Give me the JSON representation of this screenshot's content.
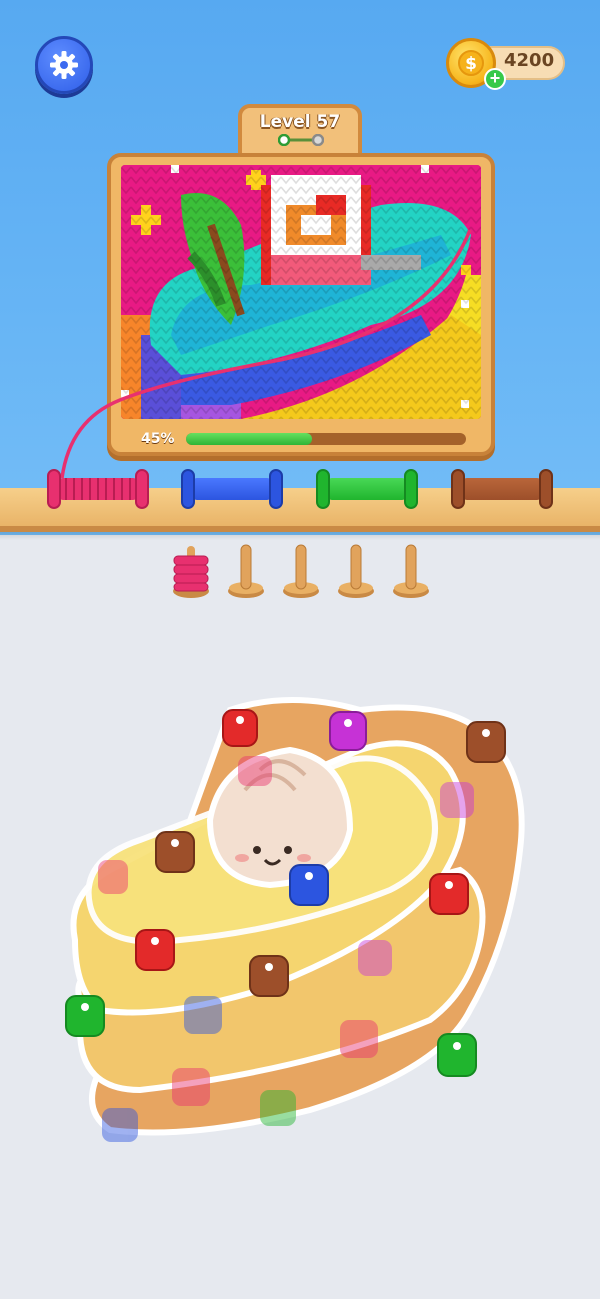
{
  "header": {
    "settings_icon": "gear-icon",
    "coins": "4200",
    "coin_icon": "dollar-coin-icon",
    "add_coins_icon": "plus-icon"
  },
  "level": {
    "label": "Level 57"
  },
  "artwork": {
    "subject": "rose-pixel-art"
  },
  "progress": {
    "label": "45%",
    "value": 0.45
  },
  "spools": [
    {
      "color": "#e8306f",
      "state": "filling"
    },
    {
      "color": "#2c55e0",
      "state": "empty"
    },
    {
      "color": "#20b52e",
      "state": "empty"
    },
    {
      "color": "#9d4f2a",
      "state": "empty"
    }
  ],
  "holding_pegs": {
    "count": 5,
    "filled": [
      {
        "index": 0,
        "color": "#e8306f"
      }
    ]
  },
  "colors": {
    "sky": "#67b5f5",
    "shelf": "#efc27a",
    "floor": "#e6e9ef",
    "progress_fill": "#3cc140"
  }
}
